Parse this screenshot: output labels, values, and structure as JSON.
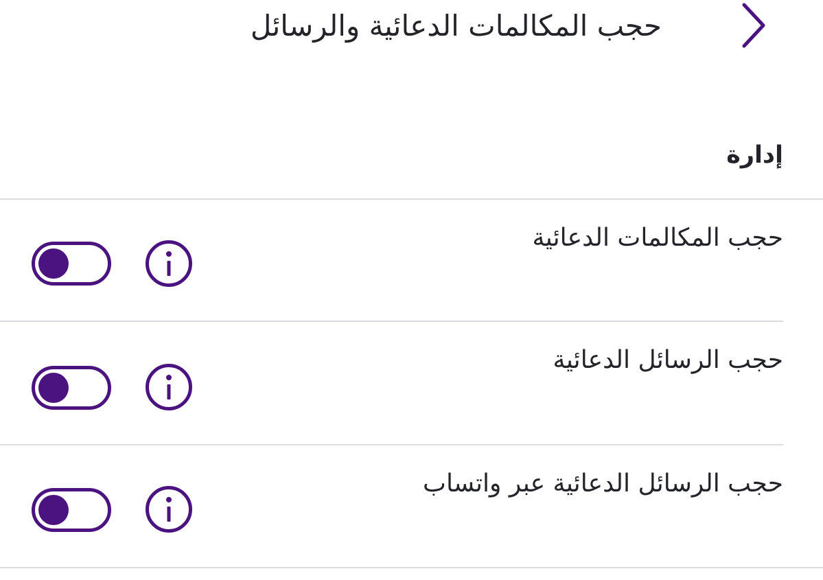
{
  "header": {
    "title": "حجب المكالمات الدعائية والرسائل",
    "back_icon": "chevron-right-icon"
  },
  "section": {
    "title": "إدارة"
  },
  "settings": [
    {
      "label": "حجب المكالمات الدعائية",
      "enabled": false,
      "info_icon": "info-icon"
    },
    {
      "label": "حجب الرسائل الدعائية",
      "enabled": false,
      "info_icon": "info-icon"
    },
    {
      "label": "حجب الرسائل الدعائية عبر واتساب",
      "enabled": false,
      "info_icon": "info-icon"
    }
  ],
  "colors": {
    "accent": "#4a137f",
    "text": "#23232a",
    "divider": "#dcdce0",
    "background": "#ffffff"
  }
}
